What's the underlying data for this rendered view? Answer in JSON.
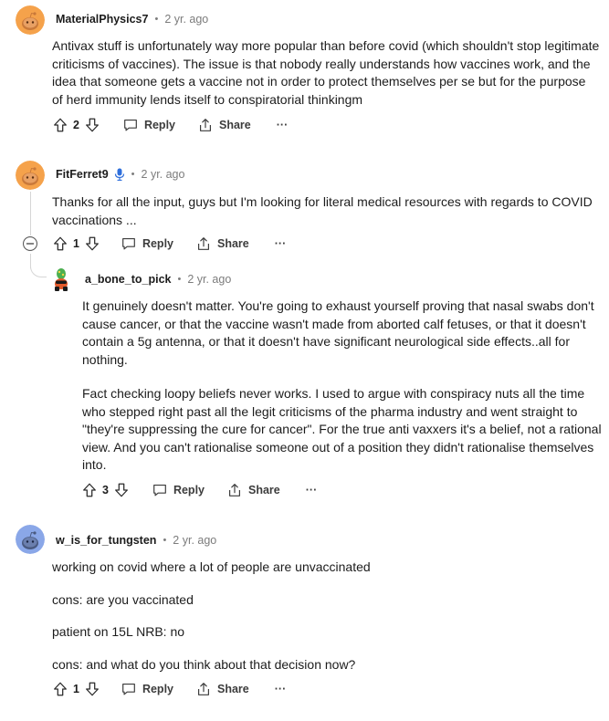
{
  "comments": [
    {
      "user": "MaterialPhysics7",
      "sep": "•",
      "time": "2 yr. ago",
      "paragraphs": [
        "Antivax stuff is unfortunately way more popular than before covid (which shouldn't stop legitimate criticisms of vaccines). The issue is that nobody really understands how vaccines work, and the idea that someone gets a vaccine not in order to protect themselves per se but for the purpose of herd immunity lends itself to conspiratorial thinkingm"
      ],
      "votes": "2",
      "reply_label": "Reply",
      "share_label": "Share",
      "more_label": "···"
    },
    {
      "user": "FitFerret9",
      "sep": "•",
      "time": "2 yr. ago",
      "paragraphs": [
        "Thanks for all the input, guys but I'm looking for literal medical resources with regards to COVID vaccinations ..."
      ],
      "votes": "1",
      "reply_label": "Reply",
      "share_label": "Share",
      "more_label": "···"
    },
    {
      "user": "a_bone_to_pick",
      "sep": "•",
      "time": "2 yr. ago",
      "paragraphs": [
        "It genuinely doesn't matter. You're going to exhaust yourself proving that nasal swabs don't cause cancer, or that the vaccine wasn't made from aborted calf fetuses, or that it doesn't contain a 5g antenna, or that it doesn't have significant neurological side effects..all for nothing.",
        "Fact checking loopy beliefs never works. I used to argue with conspiracy nuts all the time who stepped right past all the legit criticisms of the pharma industry and went straight to \"they're suppressing the cure for cancer\". For the true anti vaxxers it's a belief, not a rational view. And you can't rationalise someone out of a position they didn't rationalise themselves into."
      ],
      "votes": "3",
      "reply_label": "Reply",
      "share_label": "Share",
      "more_label": "···"
    },
    {
      "user": "w_is_for_tungsten",
      "sep": "•",
      "time": "2 yr. ago",
      "paragraphs": [
        "working on covid where a lot of people are unvaccinated",
        "cons: are you vaccinated",
        "patient on 15L NRB: no",
        "cons: and what do you think about that decision now?"
      ],
      "votes": "1",
      "reply_label": "Reply",
      "share_label": "Share",
      "more_label": "···"
    }
  ],
  "icons": {
    "upvote": "upvote-arrow-icon",
    "downvote": "downvote-arrow-icon",
    "reply": "speech-bubble-icon",
    "share": "share-arrow-icon",
    "collapse": "minus-circle-icon",
    "mic": "microphone-icon"
  },
  "colors": {
    "avatar_orange": "#f5a24b",
    "avatar_blue": "#8aa7e8",
    "mic_blue": "#2f6fdb",
    "meta_gray": "#7c7c7c"
  }
}
